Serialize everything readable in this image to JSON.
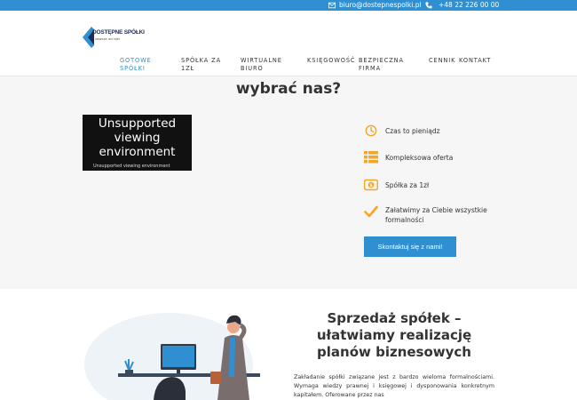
{
  "topbar": {
    "email": "biuro@dostepnespolki.pl",
    "phone": "+48 22 226 00 00",
    "bg_color": "#2f8fd1"
  },
  "logo": {
    "name": "DOSTĘPNE SPÓŁKI",
    "tagline": "zawsze od ręki"
  },
  "nav": {
    "items": [
      {
        "label": "GOTOWE SPÓŁKI",
        "active": true
      },
      {
        "label": "SPÓŁKA ZA 1ZŁ"
      },
      {
        "label": "WIRTUALNE BIURO"
      },
      {
        "label": "KSIĘGOWOŚĆ"
      },
      {
        "label": "BEZPIECZNA FIRMA"
      },
      {
        "label": "CENNIK"
      },
      {
        "label": "KONTAKT"
      }
    ]
  },
  "why": {
    "heading": "wybrać nas?",
    "video": {
      "message": "Unsupported viewing environment",
      "small": "Unsupported viewing environment"
    },
    "features": [
      {
        "icon": "clock-icon",
        "label": "Czas to pieniądz"
      },
      {
        "icon": "list-icon",
        "label": "Kompleksowa oferta"
      },
      {
        "icon": "coin-icon",
        "label": "Spółka za 1zł"
      },
      {
        "icon": "check-icon",
        "label": "Załatwimy za Ciebie wszystkie formalności"
      }
    ],
    "cta": "Skontaktuj się z nami!"
  },
  "sales": {
    "heading": "Sprzedaż spółek – ułatwiamy realizację planów biznesowych",
    "paragraph": "Zakładanie spółki związane jest z bardzo wieloma formalnościami. Wymaga wiedzy prawnej i księgowej i dysponowania konkretnym kapitałem. Oferowane przez nas"
  },
  "colors": {
    "accent": "#2f8fd1",
    "icon_orange": "#f5a623",
    "section_bg": "#f6f6f6"
  }
}
